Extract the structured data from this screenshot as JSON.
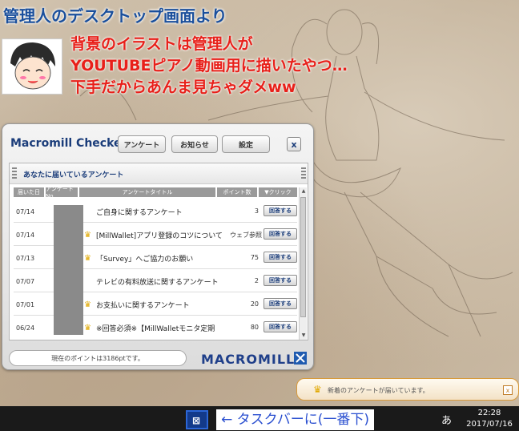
{
  "desktop": {
    "caption_title": "管理人のデスクトップ画面より",
    "caption_lines": [
      "背景のイラストは管理人が",
      "YOUTUBEピアノ動画用に描いたやつ…",
      "下手だからあんま見ちゃダメww"
    ]
  },
  "widget": {
    "title": "Macromill Checker",
    "buttons": {
      "survey": "アンケート",
      "news": "お知らせ",
      "settings": "設定"
    },
    "close_label": "x",
    "panel_title": "あなたに届いているアンケート",
    "columns": [
      "届いた日",
      "アンケートNo.",
      "アンケートタイトル",
      "ポイント数",
      "▼クリック"
    ],
    "rows": [
      {
        "date": "07/14",
        "crown": false,
        "title": "ご自身に関するアンケート",
        "points": "3",
        "action": "回答する"
      },
      {
        "date": "07/14",
        "crown": true,
        "title": "[MillWallet]アプリ登録のコツについて",
        "points": "ウェブ参照",
        "action": "回答する"
      },
      {
        "date": "07/13",
        "crown": true,
        "title": "「Survey」へご協力のお願い",
        "points": "75",
        "action": "回答する"
      },
      {
        "date": "07/07",
        "crown": false,
        "title": "テレビの有料放送に関するアンケート",
        "points": "2",
        "action": "回答する"
      },
      {
        "date": "07/01",
        "crown": true,
        "title": "お支払いに関するアンケート",
        "points": "20",
        "action": "回答する"
      },
      {
        "date": "06/24",
        "crown": true,
        "title": "※回答必須※【MillWalletモニタ定期",
        "points": "80",
        "action": "回答する"
      }
    ],
    "points_text": "現在のポイントは3186ptです。",
    "logo": "MACROMILL"
  },
  "toast": {
    "message": "新着のアンケートが届いています。",
    "close_label": "x"
  },
  "taskbar": {
    "arrow_text": "← タスクバーに(一番下)",
    "ime": "あ",
    "time": "22:28",
    "date": "2017/07/16"
  },
  "colors": {
    "caption_blue": "#1a4f9c",
    "caption_red": "#e8201a",
    "brand_blue": "#1f3f8a",
    "toast_border": "#d89a3a"
  }
}
